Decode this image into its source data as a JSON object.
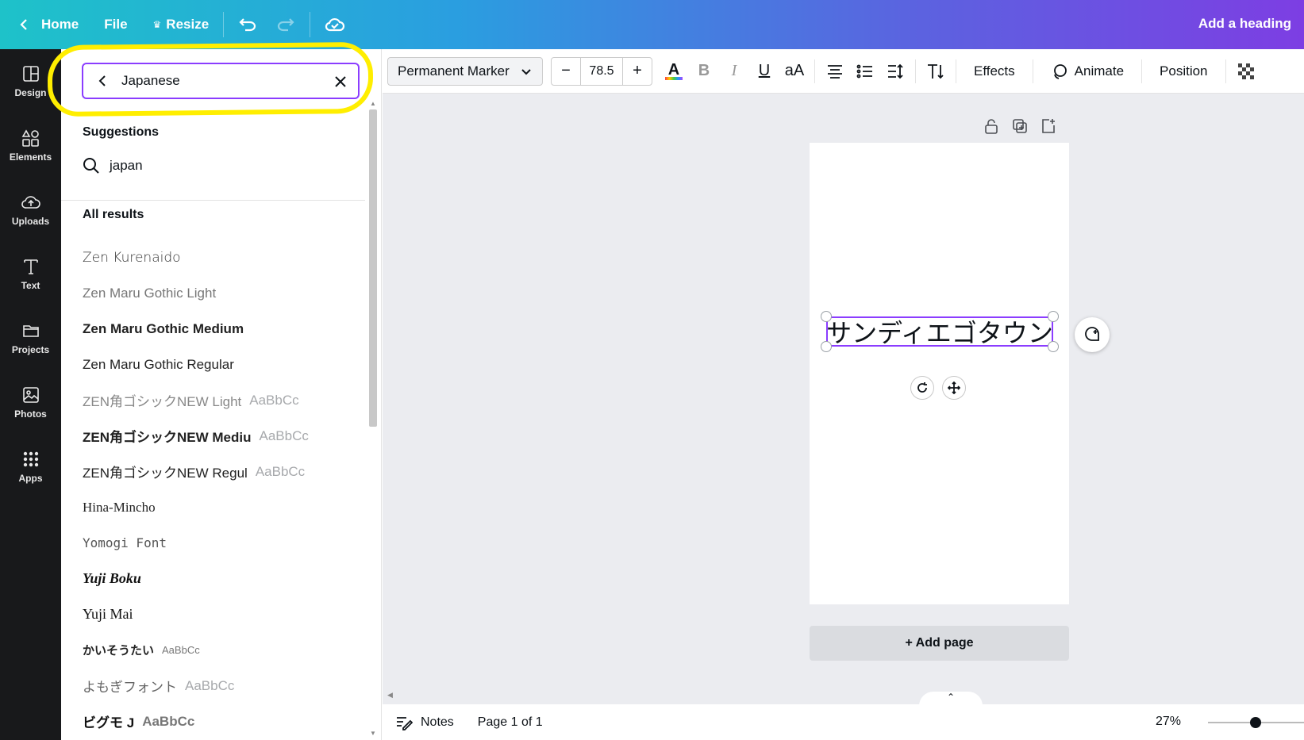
{
  "header": {
    "home": "Home",
    "file": "File",
    "resize": "Resize",
    "title": "Add a heading"
  },
  "rail": [
    {
      "label": "Design",
      "icon": "design-icon"
    },
    {
      "label": "Elements",
      "icon": "elements-icon"
    },
    {
      "label": "Uploads",
      "icon": "uploads-icon"
    },
    {
      "label": "Text",
      "icon": "text-icon"
    },
    {
      "label": "Projects",
      "icon": "folder-icon"
    },
    {
      "label": "Photos",
      "icon": "photos-icon"
    },
    {
      "label": "Apps",
      "icon": "apps-icon"
    }
  ],
  "search": {
    "value": "Japanese",
    "highlight_color": "#ffee00"
  },
  "suggestions": {
    "title": "Suggestions",
    "items": [
      "japan"
    ]
  },
  "results": {
    "title": "All results",
    "fonts": [
      {
        "name": "Zen Kurenaido",
        "preview": ""
      },
      {
        "name": "Zen Maru Gothic Light",
        "preview": ""
      },
      {
        "name": "Zen Maru Gothic Medium",
        "preview": ""
      },
      {
        "name": "Zen Maru Gothic Regular",
        "preview": ""
      },
      {
        "name": "ZEN角ゴシックNEW Light",
        "preview": "AaBbCc"
      },
      {
        "name": "ZEN角ゴシックNEW Mediu",
        "preview": "AaBbCc"
      },
      {
        "name": "ZEN角ゴシックNEW Regul",
        "preview": "AaBbCc"
      },
      {
        "name": "Hina-Mincho",
        "preview": ""
      },
      {
        "name": "Yomogi Font",
        "preview": ""
      },
      {
        "name": "Yuji Boku",
        "preview": ""
      },
      {
        "name": "Yuji Mai",
        "preview": ""
      },
      {
        "name": "かいそうたい",
        "preview": "AaBbCc"
      },
      {
        "name": "よもぎフォント",
        "preview": "AaBbCc"
      },
      {
        "name": "ビグモ J",
        "preview": "AaBbCc"
      }
    ]
  },
  "toolbar": {
    "font": "Permanent Marker",
    "size": "78.5",
    "minus": "−",
    "plus": "+",
    "effects": "Effects",
    "animate": "Animate",
    "position": "Position"
  },
  "canvas": {
    "text": "サンディエゴタウン",
    "add_page": "+ Add page"
  },
  "footer": {
    "notes": "Notes",
    "page": "Page 1 of 1",
    "zoom": "27%",
    "zoom_level": 0.27
  },
  "colors": {
    "accent": "#8b3dff",
    "rail_bg": "#18191b",
    "canvas_bg": "#ebecf0"
  }
}
